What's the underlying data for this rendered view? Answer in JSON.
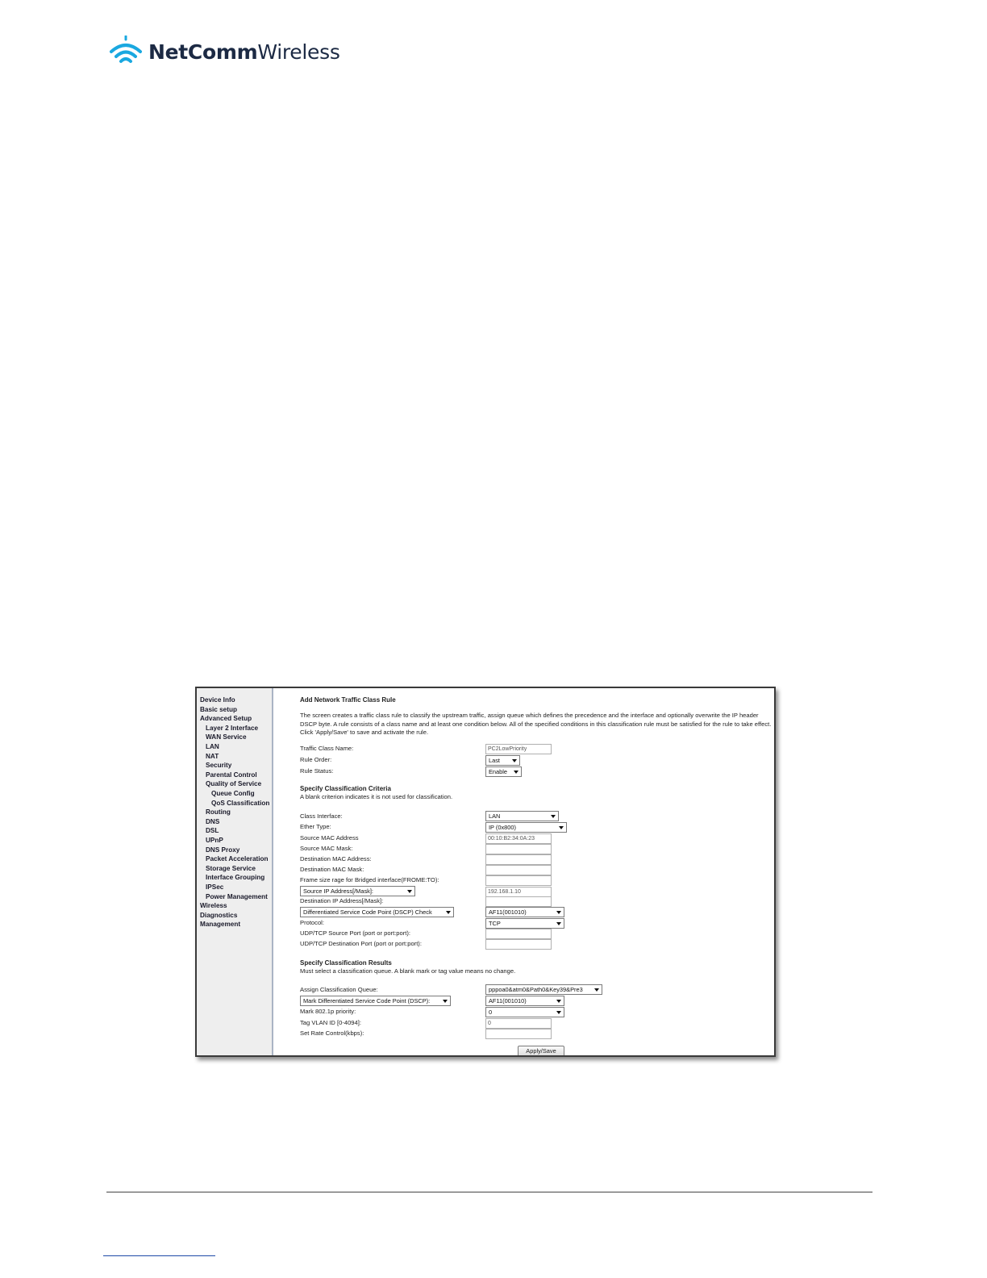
{
  "brand": {
    "name_bold": "NetComm",
    "name_regular": "Wireless",
    "color": "#1c2a44"
  },
  "sidebar": {
    "items": [
      {
        "label": "Device Info",
        "level": 0
      },
      {
        "label": "Basic setup",
        "level": 0
      },
      {
        "label": "Advanced Setup",
        "level": 0
      },
      {
        "label": "Layer 2 Interface",
        "level": 1
      },
      {
        "label": "WAN Service",
        "level": 1
      },
      {
        "label": "LAN",
        "level": 1
      },
      {
        "label": "NAT",
        "level": 1
      },
      {
        "label": "Security",
        "level": 1
      },
      {
        "label": "Parental Control",
        "level": 1
      },
      {
        "label": "Quality of Service",
        "level": 1
      },
      {
        "label": "Queue Config",
        "level": 2
      },
      {
        "label": "QoS Classification",
        "level": 2
      },
      {
        "label": "Routing",
        "level": 1
      },
      {
        "label": "DNS",
        "level": 1
      },
      {
        "label": "DSL",
        "level": 1
      },
      {
        "label": "UPnP",
        "level": 1
      },
      {
        "label": "DNS Proxy",
        "level": 1
      },
      {
        "label": "Packet Acceleration",
        "level": 1
      },
      {
        "label": "Storage Service",
        "level": 1
      },
      {
        "label": "Interface Grouping",
        "level": 1
      },
      {
        "label": "IPSec",
        "level": 1
      },
      {
        "label": "Power Management",
        "level": 1
      },
      {
        "label": "Wireless",
        "level": 0
      },
      {
        "label": "Diagnostics",
        "level": 0
      },
      {
        "label": "Management",
        "level": 0
      }
    ]
  },
  "page": {
    "title": "Add Network Traffic Class Rule",
    "description": "The screen creates a traffic class rule to classify the upstream traffic, assign queue which defines the precedence and the interface and optionally overwrite the IP header DSCP byte. A rule consists of a class name and at least one condition below. All of the specified conditions in this classification rule must be satisfied for the rule to take effect. Click 'Apply/Save' to save and activate the rule.",
    "traffic_class_name": {
      "label": "Traffic Class Name:",
      "value": "PC2LowPriority"
    },
    "rule_order": {
      "label": "Rule Order:",
      "value": "Last"
    },
    "rule_status": {
      "label": "Rule Status:",
      "value": "Enable"
    },
    "criteria": {
      "heading": "Specify Classification Criteria",
      "note": "A blank criterion indicates it is not used for classification.",
      "class_interface": {
        "label": "Class Interface:",
        "value": "LAN"
      },
      "ether_type": {
        "label": "Ether Type:",
        "value": "IP (0x800)"
      },
      "source_mac": {
        "label": "Source MAC Address",
        "value": "00:10:B2:34:0A:23"
      },
      "source_mac_mask": {
        "label": "Source MAC Mask:",
        "value": ""
      },
      "dest_mac": {
        "label": "Destination MAC Address:",
        "value": ""
      },
      "dest_mac_mask": {
        "label": "Destination MAC Mask:",
        "value": ""
      },
      "frame_size": {
        "label": "Frame size rage for Bridged interface(FROME:TO):",
        "value": ""
      },
      "source_ip": {
        "label": "Source IP Address[/Mask]:",
        "value": "192.168.1.10"
      },
      "dest_ip": {
        "label": "Destination IP Address[/Mask]:",
        "value": ""
      },
      "dscp_check": {
        "label": "Differentiated Service Code Point (DSCP) Check",
        "value": "AF11(001010)"
      },
      "protocol": {
        "label": "Protocol:",
        "value": "TCP"
      },
      "udp_tcp_src_port": {
        "label": "UDP/TCP Source Port (port or port:port):",
        "value": ""
      },
      "udp_tcp_dst_port": {
        "label": "UDP/TCP Destination Port (port or port:port):",
        "value": ""
      }
    },
    "results": {
      "heading": "Specify Classification Results",
      "note": "Must select a classification queue. A blank mark or tag value means no change.",
      "queue": {
        "label": "Assign Classification Queue:",
        "value": "pppoa0&atm0&Path0&Key39&Pre3"
      },
      "mark_dscp": {
        "label": "Mark Differentiated Service Code Point (DSCP):",
        "value": "AF11(001010)"
      },
      "mark_8021p": {
        "label": "Mark 802.1p priority:",
        "value": "0"
      },
      "vlan_id": {
        "label": "Tag VLAN ID [0-4094]:",
        "value": "0"
      },
      "rate_control": {
        "label": "Set Rate Control(kbps):",
        "value": ""
      }
    },
    "apply_label": "Apply/Save"
  }
}
